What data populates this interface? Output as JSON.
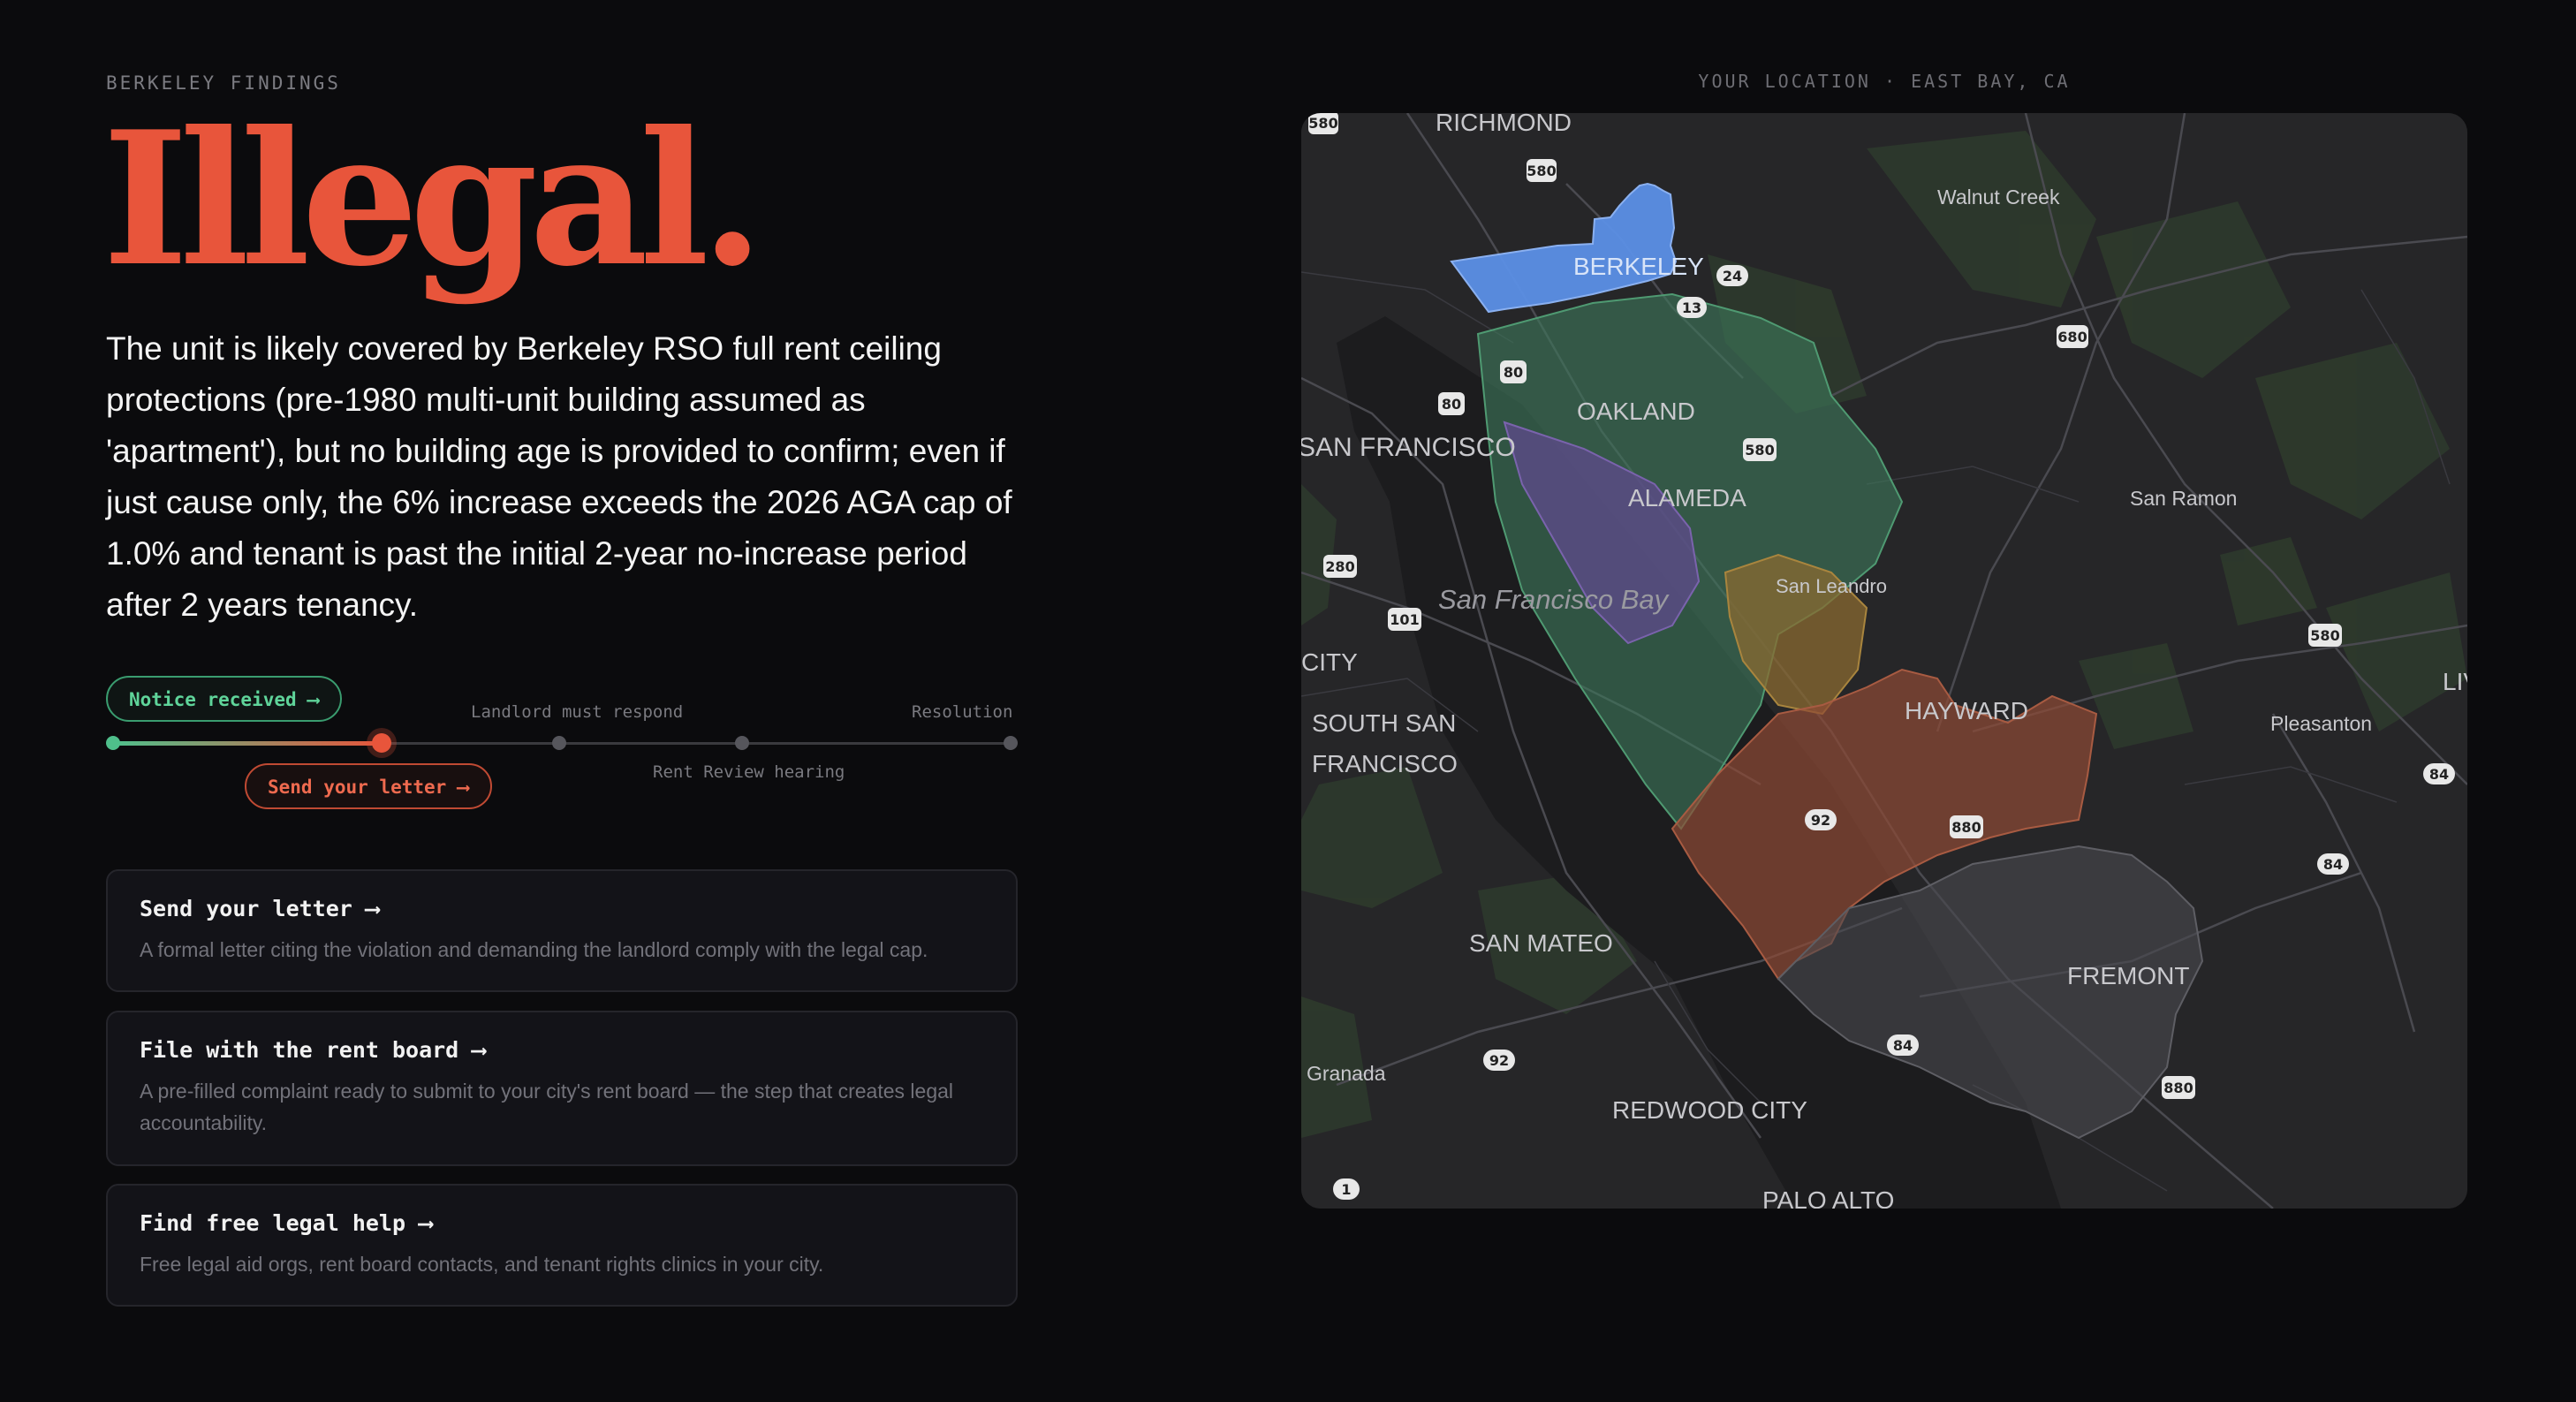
{
  "eyebrow": "BERKELEY FINDINGS",
  "verdict": "Illegal.",
  "summary": "The unit is likely covered by Berkeley RSO full rent ceiling protections (pre-1980 multi-unit building assumed as 'apartment'), but no building age is provided to confirm; even if just cause only, the 6% increase exceeds the 2026 AGA cap of 1.0% and tenant is past the initial 2-year no-increase period after 2 years tenancy.",
  "timeline": {
    "notice": "Notice received ⟶",
    "letter": "Send your letter ⟶",
    "respond": "Landlord must respond",
    "hearing": "Rent Review hearing",
    "resolution": "Resolution",
    "progress": 0.3
  },
  "actions": [
    {
      "title": "Send your letter ⟶",
      "desc": "A formal letter citing the violation and demanding the landlord comply with the legal cap."
    },
    {
      "title": "File with the rent board ⟶",
      "desc": "A pre-filled complaint ready to submit to your city's rent board — the step that creates legal accountability."
    },
    {
      "title": "Find free legal help ⟶",
      "desc": "Free legal aid orgs, rent board contacts, and tenant rights clinics in your city."
    }
  ],
  "map": {
    "eyebrow": "YOUR LOCATION · EAST BAY, CA",
    "places": {
      "richmond": "RICHMOND",
      "berkeley": "BERKELEY",
      "oakland": "OAKLAND",
      "alameda": "ALAMEDA",
      "san_francisco": "SAN FRANCISCO",
      "sf_bay": "San Francisco Bay",
      "san_leandro": "San Leandro",
      "hayward": "HAYWARD",
      "walnut_creek": "Walnut Creek",
      "san_ramon": "San Ramon",
      "pleasanton": "Pleasanton",
      "south_sf_1": "SOUTH SAN",
      "south_sf_2": "FRANCISCO",
      "city": "CITY",
      "san_mateo": "SAN MATEO",
      "fremont": "FREMONT",
      "redwood_city": "REDWOOD CITY",
      "palo_alto": "PALO ALTO",
      "granada": "Granada",
      "liv": "LIV"
    },
    "highways": {
      "h580a": "580",
      "h580b": "580",
      "h24": "24",
      "h13": "13",
      "h680": "680",
      "h80a": "80",
      "h80b": "80",
      "h580c": "580",
      "h280": "280",
      "h101": "101",
      "h580d": "580",
      "h84a": "84",
      "h92a": "92",
      "h880a": "880",
      "h84b": "84",
      "h84c": "84",
      "h92b": "92",
      "h880b": "880",
      "h1": "1"
    },
    "colors": {
      "berkeley": "#5b8fe6",
      "oakland": "#3d7a5b",
      "alameda": "#5f4a8c",
      "san_leandro": "#8a6a30",
      "hayward": "#8f4a35",
      "fremont": "#4a4a4f"
    }
  }
}
